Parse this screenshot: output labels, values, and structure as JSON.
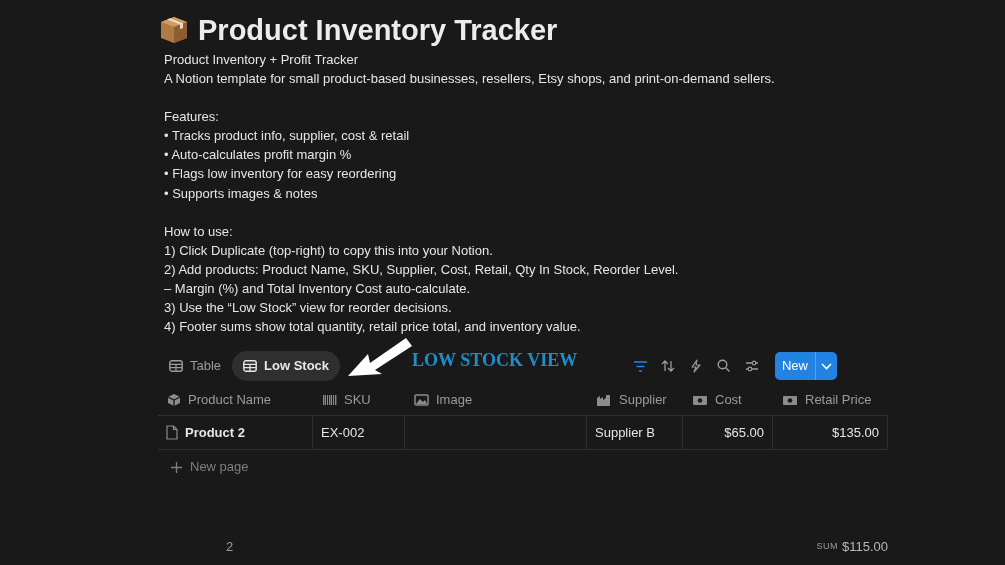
{
  "page": {
    "title": "Product Inventory Tracker"
  },
  "description": [
    [
      "Product Inventory + Profit Tracker",
      "A Notion template for small product-based businesses, resellers, Etsy shops, and print-on-demand sellers."
    ],
    [
      "Features:",
      "• Tracks product info, supplier, cost & retail",
      "• Auto-calculates profit margin %",
      "• Flags low inventory for easy reordering",
      "• Supports images & notes"
    ],
    [
      "How to use:",
      "1) Click Duplicate (top-right) to copy this into your Notion.",
      "2) Add products: Product Name, SKU, Supplier, Cost, Retail, Qty In Stock, Reorder Level.",
      "– Margin (%) and Total Inventory Cost auto-calculate.",
      "3) Use the “Low Stock” view for reorder decisions.",
      "4) Footer sums show total quantity, retail price total, and inventory value."
    ]
  ],
  "views": [
    {
      "label": "Table",
      "selected": false
    },
    {
      "label": "Low Stock",
      "selected": true
    }
  ],
  "annotation": "LOW STOCK VIEW",
  "toolbar": {
    "filter_active": true,
    "new_button": "New"
  },
  "table": {
    "columns": [
      {
        "label": "Product Name",
        "kind": "title"
      },
      {
        "label": "SKU",
        "kind": "code"
      },
      {
        "label": "Image",
        "kind": "files"
      },
      {
        "label": "Supplier",
        "kind": "place"
      },
      {
        "label": "Cost",
        "kind": "money"
      },
      {
        "label": "Retail Price",
        "kind": "money"
      }
    ],
    "rows": [
      {
        "cells": [
          "Product 2",
          "EX-002",
          "",
          "Supplier B",
          "$65.00",
          "$135.00"
        ]
      }
    ],
    "new_row": "New page",
    "footer": {
      "count": "2",
      "sum_label": "SUM",
      "sum": "$115.00"
    }
  }
}
